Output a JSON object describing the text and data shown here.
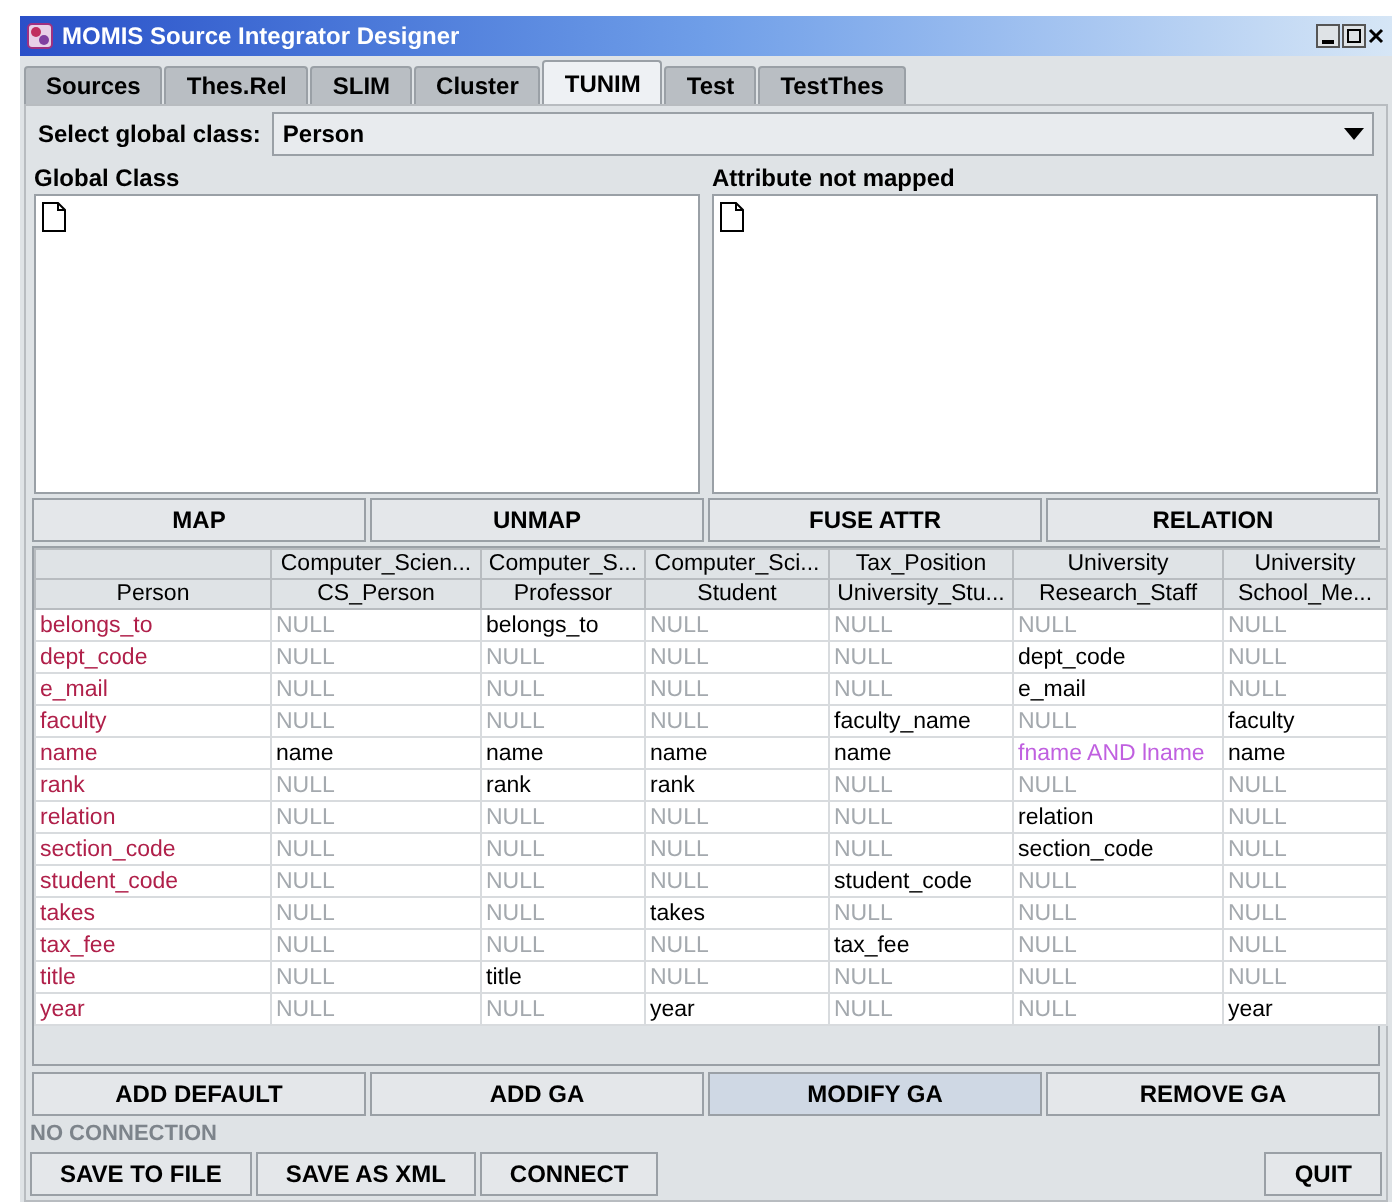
{
  "window": {
    "title": "MOMIS Source Integrator Designer"
  },
  "tabs": [
    {
      "label": "Sources",
      "selected": false
    },
    {
      "label": "Thes.Rel",
      "selected": false
    },
    {
      "label": "SLIM",
      "selected": false
    },
    {
      "label": "Cluster",
      "selected": false
    },
    {
      "label": "TUNIM",
      "selected": true
    },
    {
      "label": "Test",
      "selected": false
    },
    {
      "label": "TestThes",
      "selected": false
    }
  ],
  "global_class_select": {
    "label": "Select global class:",
    "value": "Person"
  },
  "panels": [
    {
      "title": "Global Class"
    },
    {
      "title": "Attribute not mapped"
    }
  ],
  "action_buttons": [
    {
      "label": "MAP",
      "focused": false
    },
    {
      "label": "UNMAP",
      "focused": false
    },
    {
      "label": "FUSE ATTR",
      "focused": false
    },
    {
      "label": "RELATION",
      "focused": false
    }
  ],
  "table": {
    "attribute_column": {
      "class": "Person"
    },
    "columns": [
      {
        "source": "Computer_Scien...",
        "class": "CS_Person"
      },
      {
        "source": "Computer_S...",
        "class": "Professor"
      },
      {
        "source": "Computer_Sci...",
        "class": "Student"
      },
      {
        "source": "Tax_Position",
        "class": "University_Stu..."
      },
      {
        "source": "University",
        "class": "Research_Staff"
      },
      {
        "source": "University",
        "class": "School_Me..."
      }
    ],
    "rows": [
      {
        "attribute": "belongs_to",
        "cells": [
          {
            "kind": "null",
            "text": "NULL"
          },
          {
            "kind": "value",
            "text": "belongs_to"
          },
          {
            "kind": "null",
            "text": "NULL"
          },
          {
            "kind": "null",
            "text": "NULL"
          },
          {
            "kind": "null",
            "text": "NULL"
          },
          {
            "kind": "null",
            "text": "NULL"
          }
        ]
      },
      {
        "attribute": "dept_code",
        "cells": [
          {
            "kind": "null",
            "text": "NULL"
          },
          {
            "kind": "null",
            "text": "NULL"
          },
          {
            "kind": "null",
            "text": "NULL"
          },
          {
            "kind": "null",
            "text": "NULL"
          },
          {
            "kind": "value",
            "text": "dept_code"
          },
          {
            "kind": "null",
            "text": "NULL"
          }
        ]
      },
      {
        "attribute": "e_mail",
        "cells": [
          {
            "kind": "null",
            "text": "NULL"
          },
          {
            "kind": "null",
            "text": "NULL"
          },
          {
            "kind": "null",
            "text": "NULL"
          },
          {
            "kind": "null",
            "text": "NULL"
          },
          {
            "kind": "value",
            "text": "e_mail"
          },
          {
            "kind": "null",
            "text": "NULL"
          }
        ]
      },
      {
        "attribute": "faculty",
        "cells": [
          {
            "kind": "null",
            "text": "NULL"
          },
          {
            "kind": "null",
            "text": "NULL"
          },
          {
            "kind": "null",
            "text": "NULL"
          },
          {
            "kind": "value",
            "text": "faculty_name"
          },
          {
            "kind": "null",
            "text": "NULL"
          },
          {
            "kind": "value",
            "text": "faculty"
          }
        ]
      },
      {
        "attribute": "name",
        "cells": [
          {
            "kind": "value",
            "text": "name"
          },
          {
            "kind": "value",
            "text": "name"
          },
          {
            "kind": "value",
            "text": "name"
          },
          {
            "kind": "value",
            "text": "name"
          },
          {
            "kind": "fused",
            "text": "fname AND lname"
          },
          {
            "kind": "value",
            "text": "name"
          }
        ]
      },
      {
        "attribute": "rank",
        "cells": [
          {
            "kind": "null",
            "text": "NULL"
          },
          {
            "kind": "value",
            "text": "rank"
          },
          {
            "kind": "value",
            "text": "rank"
          },
          {
            "kind": "null",
            "text": "NULL"
          },
          {
            "kind": "null",
            "text": "NULL"
          },
          {
            "kind": "null",
            "text": "NULL"
          }
        ]
      },
      {
        "attribute": "relation",
        "cells": [
          {
            "kind": "null",
            "text": "NULL"
          },
          {
            "kind": "null",
            "text": "NULL"
          },
          {
            "kind": "null",
            "text": "NULL"
          },
          {
            "kind": "null",
            "text": "NULL"
          },
          {
            "kind": "value",
            "text": "relation"
          },
          {
            "kind": "null",
            "text": "NULL"
          }
        ]
      },
      {
        "attribute": "section_code",
        "cells": [
          {
            "kind": "null",
            "text": "NULL"
          },
          {
            "kind": "null",
            "text": "NULL"
          },
          {
            "kind": "null",
            "text": "NULL"
          },
          {
            "kind": "null",
            "text": "NULL"
          },
          {
            "kind": "value",
            "text": "section_code"
          },
          {
            "kind": "null",
            "text": "NULL"
          }
        ]
      },
      {
        "attribute": "student_code",
        "cells": [
          {
            "kind": "null",
            "text": "NULL"
          },
          {
            "kind": "null",
            "text": "NULL"
          },
          {
            "kind": "null",
            "text": "NULL"
          },
          {
            "kind": "value",
            "text": "student_code"
          },
          {
            "kind": "null",
            "text": "NULL"
          },
          {
            "kind": "null",
            "text": "NULL"
          }
        ]
      },
      {
        "attribute": "takes",
        "cells": [
          {
            "kind": "null",
            "text": "NULL"
          },
          {
            "kind": "null",
            "text": "NULL"
          },
          {
            "kind": "value",
            "text": "takes"
          },
          {
            "kind": "null",
            "text": "NULL"
          },
          {
            "kind": "null",
            "text": "NULL"
          },
          {
            "kind": "null",
            "text": "NULL"
          }
        ]
      },
      {
        "attribute": "tax_fee",
        "cells": [
          {
            "kind": "null",
            "text": "NULL"
          },
          {
            "kind": "null",
            "text": "NULL"
          },
          {
            "kind": "null",
            "text": "NULL"
          },
          {
            "kind": "value",
            "text": "tax_fee"
          },
          {
            "kind": "null",
            "text": "NULL"
          },
          {
            "kind": "null",
            "text": "NULL"
          }
        ]
      },
      {
        "attribute": "title",
        "cells": [
          {
            "kind": "null",
            "text": "NULL"
          },
          {
            "kind": "value",
            "text": "title"
          },
          {
            "kind": "null",
            "text": "NULL"
          },
          {
            "kind": "null",
            "text": "NULL"
          },
          {
            "kind": "null",
            "text": "NULL"
          },
          {
            "kind": "null",
            "text": "NULL"
          }
        ]
      },
      {
        "attribute": "year",
        "cells": [
          {
            "kind": "null",
            "text": "NULL"
          },
          {
            "kind": "null",
            "text": "NULL"
          },
          {
            "kind": "value",
            "text": "year"
          },
          {
            "kind": "null",
            "text": "NULL"
          },
          {
            "kind": "null",
            "text": "NULL"
          },
          {
            "kind": "value",
            "text": "year"
          }
        ]
      }
    ]
  },
  "ga_buttons": [
    {
      "label": "ADD DEFAULT",
      "focused": false
    },
    {
      "label": "ADD GA",
      "focused": false
    },
    {
      "label": "MODIFY GA",
      "focused": true
    },
    {
      "label": "REMOVE GA",
      "focused": false
    }
  ],
  "status": "NO CONNECTION",
  "bottom_buttons": [
    {
      "label": "SAVE TO FILE"
    },
    {
      "label": "SAVE AS XML"
    },
    {
      "label": "CONNECT"
    }
  ],
  "quit_button": {
    "label": "QUIT"
  }
}
